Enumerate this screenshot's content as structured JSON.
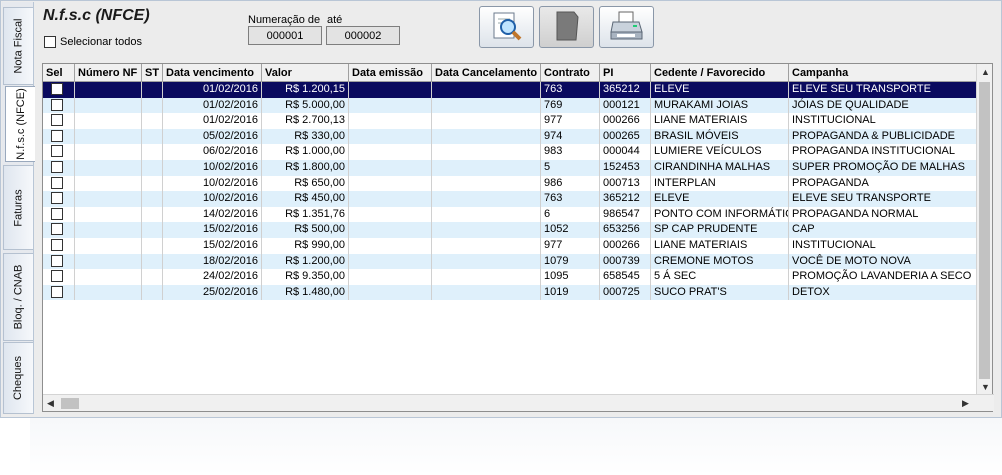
{
  "tabs": [
    {
      "label": "Nota Fiscal",
      "active": false
    },
    {
      "label": "N.f.s.c (NFCE)",
      "active": true
    },
    {
      "label": "Faturas",
      "active": false
    },
    {
      "label": "Bloq. / CNAB",
      "active": false
    },
    {
      "label": "Cheques",
      "active": false
    }
  ],
  "header": {
    "title": "N.f.s.c (NFCE)",
    "select_all_label": "Selecionar todos",
    "numeracao_label": "Numeração de",
    "ate_label": "até",
    "from_value": "000001",
    "to_value": "000002"
  },
  "toolbar": {
    "buttons": [
      {
        "icon": "search-document-icon",
        "enabled": true
      },
      {
        "icon": "blank-document-icon",
        "enabled": false
      },
      {
        "icon": "printer-icon",
        "enabled": true
      }
    ]
  },
  "grid": {
    "columns": [
      "Sel",
      "Número NF",
      "ST",
      "Data vencimento",
      "Valor",
      "Data emissão",
      "Data Cancelamento",
      "Contrato",
      "PI",
      "Cedente / Favorecido",
      "Campanha"
    ],
    "rows": [
      [
        "",
        "",
        "",
        "01/02/2016",
        "R$ 1.200,15",
        "",
        "",
        "763",
        "365212",
        "ELEVE",
        "ELEVE SEU TRANSPORTE"
      ],
      [
        "",
        "",
        "",
        "01/02/2016",
        "R$ 5.000,00",
        "",
        "",
        "769",
        "000121",
        "MURAKAMI JOIAS",
        "JÓIAS DE QUALIDADE"
      ],
      [
        "",
        "",
        "",
        "01/02/2016",
        "R$ 2.700,13",
        "",
        "",
        "977",
        "000266",
        "LIANE MATERIAIS",
        "INSTITUCIONAL"
      ],
      [
        "",
        "",
        "",
        "05/02/2016",
        "R$ 330,00",
        "",
        "",
        "974",
        "000265",
        "BRASIL MÓVEIS",
        "PROPAGANDA & PUBLICIDADE"
      ],
      [
        "",
        "",
        "",
        "06/02/2016",
        "R$ 1.000,00",
        "",
        "",
        "983",
        "000044",
        "LUMIERE VEÍCULOS",
        "PROPAGANDA INSTITUCIONAL"
      ],
      [
        "",
        "",
        "",
        "10/02/2016",
        "R$ 1.800,00",
        "",
        "",
        "5",
        "152453",
        "CIRANDINHA MALHAS",
        "SUPER PROMOÇÃO DE MALHAS"
      ],
      [
        "",
        "",
        "",
        "10/02/2016",
        "R$ 650,00",
        "",
        "",
        "986",
        "000713",
        "INTERPLAN",
        "PROPAGANDA"
      ],
      [
        "",
        "",
        "",
        "10/02/2016",
        "R$ 450,00",
        "",
        "",
        "763",
        "365212",
        "ELEVE",
        "ELEVE SEU TRANSPORTE"
      ],
      [
        "",
        "",
        "",
        "14/02/2016",
        "R$ 1.351,76",
        "",
        "",
        "6",
        "986547",
        "PONTO COM INFORMÁTICA",
        "PROPAGANDA NORMAL"
      ],
      [
        "",
        "",
        "",
        "15/02/2016",
        "R$ 500,00",
        "",
        "",
        "1052",
        "653256",
        "SP CAP PRUDENTE",
        "CAP"
      ],
      [
        "",
        "",
        "",
        "15/02/2016",
        "R$ 990,00",
        "",
        "",
        "977",
        "000266",
        "LIANE MATERIAIS",
        "INSTITUCIONAL"
      ],
      [
        "",
        "",
        "",
        "18/02/2016",
        "R$ 1.200,00",
        "",
        "",
        "1079",
        "000739",
        "CREMONE MOTOS",
        "VOCÊ DE MOTO NOVA"
      ],
      [
        "",
        "",
        "",
        "24/02/2016",
        "R$ 9.350,00",
        "",
        "",
        "1095",
        "658545",
        "5 Á SEC",
        "PROMOÇÃO LAVANDERIA A SECO"
      ],
      [
        "",
        "",
        "",
        "25/02/2016",
        "R$ 1.480,00",
        "",
        "",
        "1019",
        "000725",
        "SUCO PRAT'S",
        "DETOX"
      ]
    ],
    "selected_row": 0
  },
  "colors": {
    "selected_row_bg": "#0a0a5e",
    "alt_row_bg": "#dff0fb"
  }
}
